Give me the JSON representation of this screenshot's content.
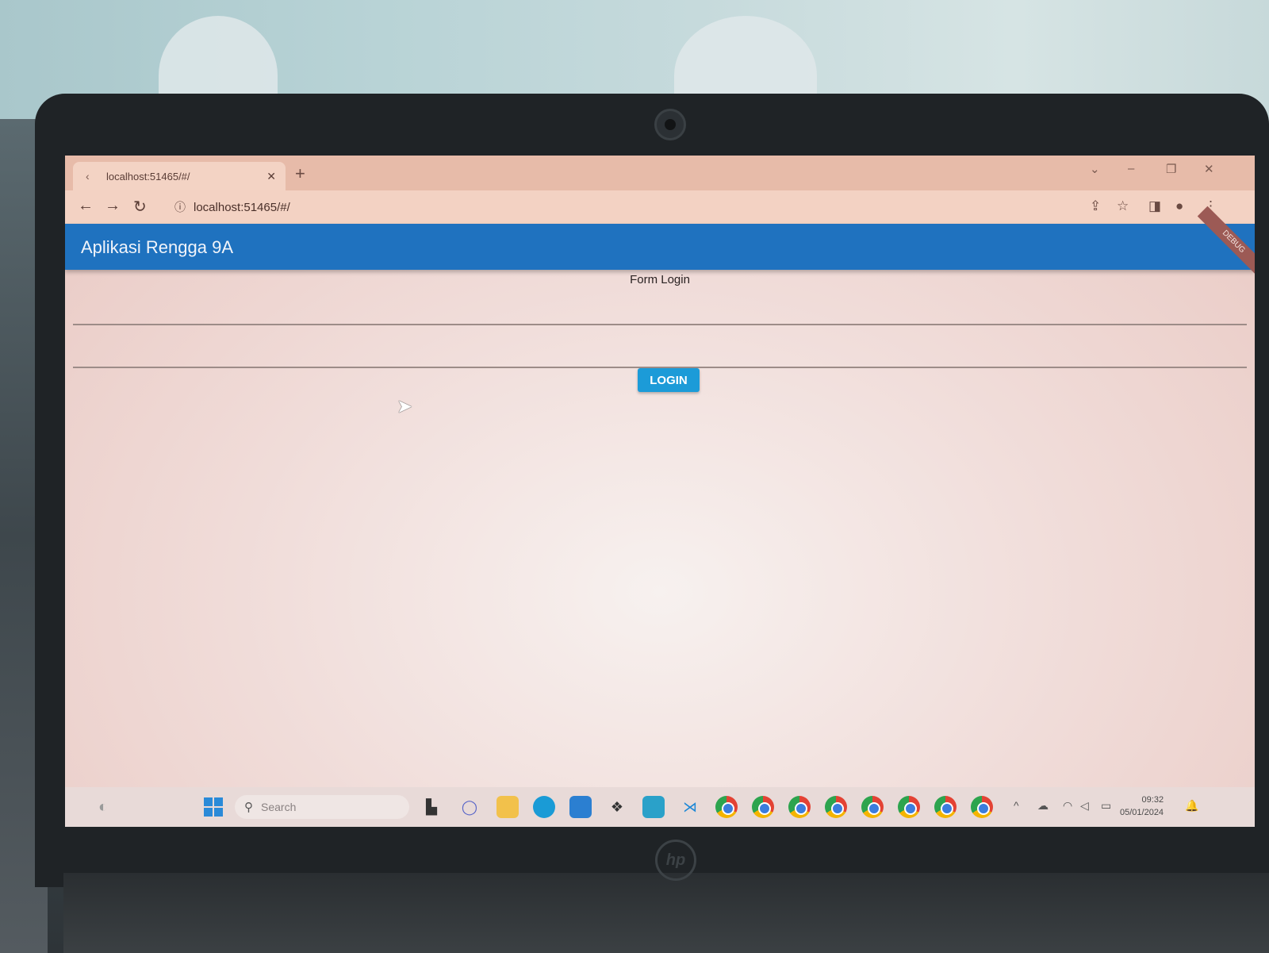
{
  "browser": {
    "tab_title": "localhost:51465/#/",
    "url": "localhost:51465/#/"
  },
  "app": {
    "title": "Aplikasi Rengga 9A",
    "debug_banner": "DEBUG",
    "form_title": "Form Login",
    "login_label": "LOGIN"
  },
  "taskbar": {
    "search_placeholder": "Search",
    "time": "09:32",
    "date": "05/01/2024",
    "icons": [
      "task-view-icon",
      "chat-icon",
      "file-explorer-icon",
      "edge-icon",
      "store-icon",
      "dropbox-icon",
      "monitor-app-icon",
      "vscode-icon",
      "chrome-icon"
    ]
  },
  "colors": {
    "appbar": "#1f72bf",
    "login_button": "#1c9bd8",
    "debug_banner": "#9c5a55"
  }
}
